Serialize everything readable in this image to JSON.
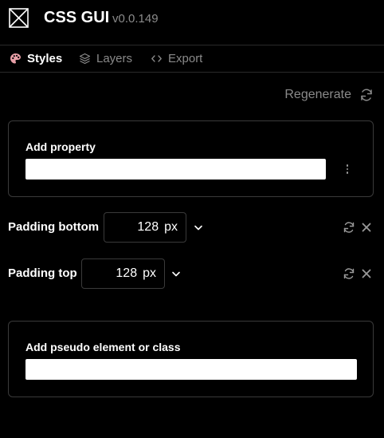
{
  "header": {
    "title": "CSS GUI",
    "version": "v0.0.149",
    "logo_icon": "crossed-box-icon"
  },
  "tabs": [
    {
      "label": "Styles",
      "icon": "palette-icon",
      "active": true
    },
    {
      "label": "Layers",
      "icon": "layers-icon",
      "active": false
    },
    {
      "label": "Export",
      "icon": "code-icon",
      "active": false
    }
  ],
  "toolbar": {
    "regenerate_label": "Regenerate",
    "regenerate_icon": "refresh-icon"
  },
  "add_property": {
    "label": "Add property",
    "value": "",
    "menu_icon": "kebab-icon"
  },
  "properties": [
    {
      "label": "Padding bottom",
      "value": "128",
      "unit": "px"
    },
    {
      "label": "Padding top",
      "value": "128",
      "unit": "px"
    }
  ],
  "add_pseudo": {
    "label": "Add pseudo element or class",
    "value": ""
  },
  "colors": {
    "background": "#000000",
    "muted_text": "#8a8a8a",
    "border": "#3a3a3a",
    "palette_accent": "#e8a0a8"
  }
}
